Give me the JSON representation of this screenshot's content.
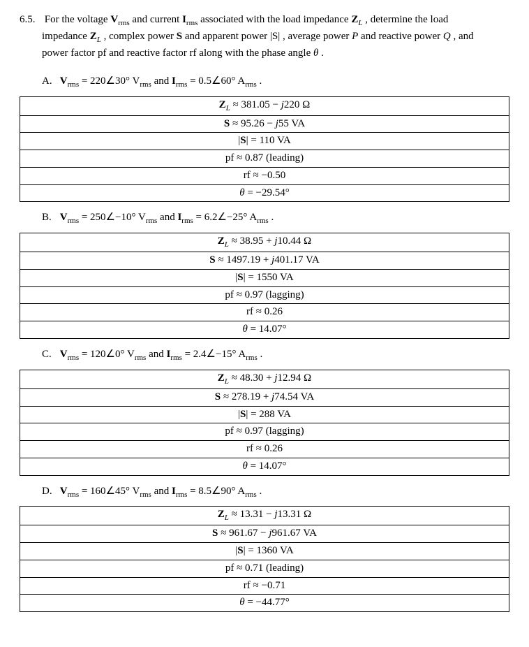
{
  "problem": {
    "number": "6.5.",
    "stem_line1_a": "For the voltage ",
    "stem_V": "V",
    "stem_rms": "rms",
    "stem_line1_b": " and current ",
    "stem_I": "I",
    "stem_line1_c": " associated with the load impedance ",
    "stem_ZL": "Z",
    "stem_Lsub": "L",
    "stem_line1_d": " , determine the load",
    "stem_line2_a": "impedance ",
    "stem_line2_b": " , complex power ",
    "stem_S": "S",
    "stem_line2_c": " and apparent power ",
    "stem_absS": "|S|",
    "stem_line2_d": " , average power ",
    "stem_P": "P",
    "stem_line2_e": "  and reactive power ",
    "stem_Q": "Q",
    "stem_line2_f": " , and",
    "stem_line3_a": "power factor pf   and reactive factor rf  along with the phase angle ",
    "stem_theta": "θ",
    "stem_line3_b": " ."
  },
  "parts": {
    "A": {
      "label": "A.",
      "given_a": " = 220∠30° ",
      "given_b": " and ",
      "given_c": " = 0.5∠60° ",
      "given_d": " .",
      "rows": [
        {
          "html": "<span class='bold'>Z</span><sub class='it'>L</sub> ≈ 381.05 − <span class='it'>j</span>220 Ω"
        },
        {
          "html": "<span class='bold'>S</span> ≈ 95.26 − <span class='it'>j</span>55 VA"
        },
        {
          "html": "|<span class='bold'>S</span>| = 110 VA"
        },
        {
          "html": "pf ≈ 0.87 (leading)"
        },
        {
          "html": "rf ≈ −0.50"
        },
        {
          "html": "<span class='it'>θ</span> = −29.54°"
        }
      ]
    },
    "B": {
      "label": "B.",
      "given_a": " = 250∠−10° ",
      "given_b": " and ",
      "given_c": " = 6.2∠−25° ",
      "given_d": " .",
      "rows": [
        {
          "html": "<span class='bold'>Z</span><sub class='it'>L</sub> ≈ 38.95 + <span class='it'>j</span>10.44 Ω"
        },
        {
          "html": "<span class='bold'>S</span> ≈ 1497.19 + <span class='it'>j</span>401.17 VA"
        },
        {
          "html": "|<span class='bold'>S</span>| = 1550 VA"
        },
        {
          "html": "pf ≈ 0.97 (lagging)"
        },
        {
          "html": "rf ≈ 0.26"
        },
        {
          "html": "<span class='it'>θ</span> = 14.07°"
        }
      ]
    },
    "C": {
      "label": "C.",
      "given_a": " = 120∠0° ",
      "given_b": " and ",
      "given_c": " = 2.4∠−15° ",
      "given_d": " .",
      "rows": [
        {
          "html": "<span class='bold'>Z</span><sub class='it'>L</sub> ≈ 48.30 + <span class='it'>j</span>12.94 Ω"
        },
        {
          "html": "<span class='bold'>S</span> ≈ 278.19 + <span class='it'>j</span>74.54 VA"
        },
        {
          "html": "|<span class='bold'>S</span>| = 288 VA"
        },
        {
          "html": "pf ≈ 0.97 (lagging)"
        },
        {
          "html": "rf ≈ 0.26"
        },
        {
          "html": "<span class='it'>θ</span> = 14.07°"
        }
      ]
    },
    "D": {
      "label": "D.",
      "given_a": " = 160∠45° ",
      "given_b": " and ",
      "given_c": " = 8.5∠90° ",
      "given_d": " .",
      "rows": [
        {
          "html": "<span class='bold'>Z</span><sub class='it'>L</sub> ≈ 13.31 − <span class='it'>j</span>13.31 Ω"
        },
        {
          "html": "<span class='bold'>S</span> ≈ 961.67 − <span class='it'>j</span>961.67 VA"
        },
        {
          "html": "|<span class='bold'>S</span>| = 1360 VA"
        },
        {
          "html": "pf ≈ 0.71 (leading)"
        },
        {
          "html": "rf ≈ −0.71"
        },
        {
          "html": "<span class='it'>θ</span> = −44.77°"
        }
      ]
    }
  }
}
